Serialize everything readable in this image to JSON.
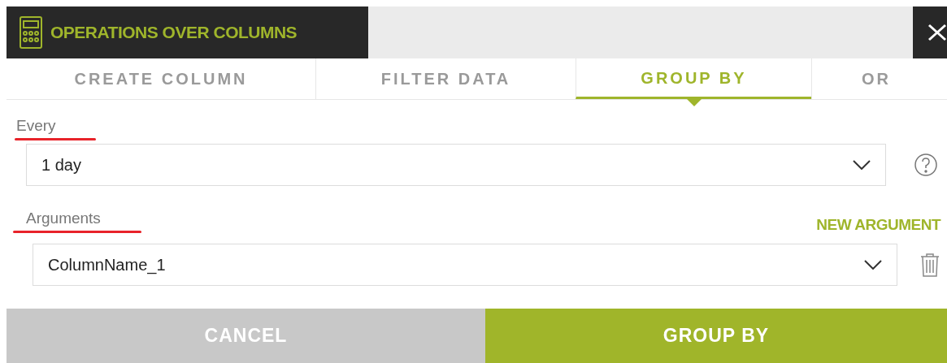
{
  "window": {
    "title": "OPERATIONS OVER COLUMNS"
  },
  "tabs": [
    {
      "label": "CREATE COLUMN",
      "selected": false
    },
    {
      "label": "FILTER DATA",
      "selected": false
    },
    {
      "label": "GROUP BY",
      "selected": true
    },
    {
      "label": "OR",
      "selected": false
    }
  ],
  "every": {
    "label": "Every",
    "value": "1 day",
    "underlined": true
  },
  "arguments": {
    "label": "Arguments",
    "underlined": true,
    "new_argument": "NEW ARGUMENT",
    "items": [
      {
        "value": "ColumnName_1"
      }
    ]
  },
  "buttons": [
    {
      "label": "CANCEL",
      "kind": "secondary"
    },
    {
      "label": "GROUP BY",
      "kind": "primary"
    }
  ]
}
